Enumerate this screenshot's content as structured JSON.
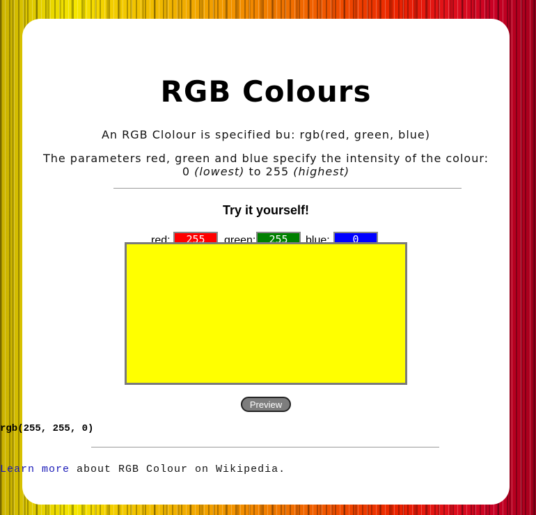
{
  "page": {
    "title": "RGB Colours",
    "intro": "An RGB Clolour is specified bu: rgb(red, green, blue)",
    "params_text": "The parameters red, green and blue specify the intensity of the colour:",
    "range": {
      "low_value": "0",
      "low_note": "(lowest)",
      "to": "to",
      "high_value": "255",
      "high_note": "(highest)"
    }
  },
  "tryit": {
    "heading": "Try it yourself!",
    "red": {
      "label": "red:",
      "value": "255",
      "color": "#ff0000"
    },
    "green": {
      "label": "green:",
      "value": "255",
      "color": "#008000"
    },
    "blue": {
      "label": "blue:",
      "value": "0",
      "color": "#0000ff"
    },
    "preview_color": "#ffff00",
    "preview_button": "Preview",
    "output": "rgb(255, 255, 0)"
  },
  "footer": {
    "link_text": "Learn more",
    "rest_text": "about RGB Colour on Wikipedia."
  }
}
